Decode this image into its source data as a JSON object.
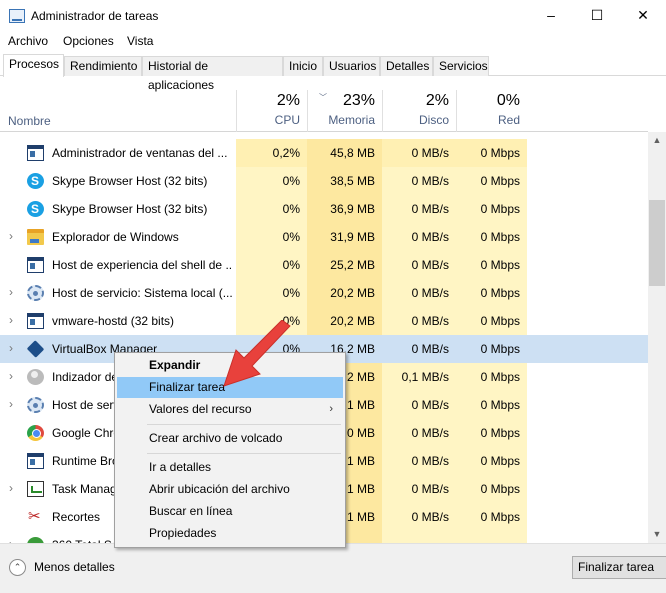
{
  "window": {
    "title": "Administrador de tareas",
    "minimize_icon": "–",
    "maximize_icon": "☐",
    "close_icon": "✕"
  },
  "menu": [
    "Archivo",
    "Opciones",
    "Vista"
  ],
  "tabs": [
    "Procesos",
    "Rendimiento",
    "Historial de aplicaciones",
    "Inicio",
    "Usuarios",
    "Detalles",
    "Servicios"
  ],
  "active_tab": "Procesos",
  "columns": {
    "name": "Nombre",
    "cpu": {
      "pct": "2%",
      "label": "CPU"
    },
    "memory": {
      "pct": "23%",
      "label": "Memoria"
    },
    "disk": {
      "pct": "2%",
      "label": "Disco"
    },
    "network": {
      "pct": "0%",
      "label": "Red"
    }
  },
  "processes": [
    {
      "name": "Administrador de ventanas del ...",
      "icon": "window-icon",
      "expandable": false,
      "cpu": "0,2%",
      "memory": "45,8 MB",
      "disk": "0 MB/s",
      "network": "0 Mbps"
    },
    {
      "name": "Skype Browser Host (32 bits)",
      "icon": "skype-icon",
      "expandable": false,
      "cpu": "0%",
      "memory": "38,5 MB",
      "disk": "0 MB/s",
      "network": "0 Mbps"
    },
    {
      "name": "Skype Browser Host (32 bits)",
      "icon": "skype-icon",
      "expandable": false,
      "cpu": "0%",
      "memory": "36,9 MB",
      "disk": "0 MB/s",
      "network": "0 Mbps"
    },
    {
      "name": "Explorador de Windows",
      "icon": "folder-icon",
      "expandable": true,
      "cpu": "0%",
      "memory": "31,9 MB",
      "disk": "0 MB/s",
      "network": "0 Mbps"
    },
    {
      "name": "Host de experiencia del shell de ...",
      "icon": "window-icon",
      "expandable": false,
      "cpu": "0%",
      "memory": "25,2 MB",
      "disk": "0 MB/s",
      "network": "0 Mbps"
    },
    {
      "name": "Host de servicio: Sistema local (...",
      "icon": "gear-icon",
      "expandable": true,
      "cpu": "0%",
      "memory": "20,2 MB",
      "disk": "0 MB/s",
      "network": "0 Mbps"
    },
    {
      "name": "vmware-hostd (32 bits)",
      "icon": "window-icon",
      "expandable": true,
      "cpu": "0%",
      "memory": "20,2 MB",
      "disk": "0 MB/s",
      "network": "0 Mbps"
    },
    {
      "name": "VirtualBox Manager",
      "icon": "virtualbox-icon",
      "expandable": true,
      "cpu": "0%",
      "memory": "16,2 MB",
      "disk": "0 MB/s",
      "network": "0 Mbps",
      "selected": true
    },
    {
      "name": "Indizador de",
      "icon": "user-icon",
      "expandable": true,
      "cpu": "",
      "memory": "2 MB",
      "disk": "0,1 MB/s",
      "network": "0 Mbps"
    },
    {
      "name": "Host de serv",
      "icon": "gear-icon",
      "expandable": true,
      "cpu": "",
      "memory": "1 MB",
      "disk": "0 MB/s",
      "network": "0 Mbps"
    },
    {
      "name": "Google Chro",
      "icon": "chrome-icon",
      "expandable": false,
      "cpu": "",
      "memory": "0 MB",
      "disk": "0 MB/s",
      "network": "0 Mbps"
    },
    {
      "name": "Runtime Bro",
      "icon": "window-icon",
      "expandable": false,
      "cpu": "",
      "memory": "1 MB",
      "disk": "0 MB/s",
      "network": "0 Mbps"
    },
    {
      "name": "Task Manag",
      "icon": "task-manager-icon",
      "expandable": true,
      "cpu": "",
      "memory": "1 MB",
      "disk": "0 MB/s",
      "network": "0 Mbps"
    },
    {
      "name": "Recortes",
      "icon": "scissors-icon",
      "expandable": false,
      "cpu": "",
      "memory": "1 MB",
      "disk": "0 MB/s",
      "network": "0 Mbps"
    },
    {
      "name": "360 Total Se",
      "icon": "shield-360-icon",
      "expandable": true,
      "cpu": "",
      "memory": "",
      "disk": "",
      "network": ""
    }
  ],
  "context_menu": {
    "expand": "Expandir",
    "end_task": "Finalizar tarea",
    "resource_values": "Valores del recurso",
    "create_dump": "Crear archivo de volcado",
    "go_to_details": "Ir a detalles",
    "open_file_location": "Abrir ubicación del archivo",
    "search_online": "Buscar en línea",
    "properties": "Propiedades",
    "submenu_arrow": "›"
  },
  "footer": {
    "less_details": "Menos detalles",
    "end_task_button": "Finalizar tarea",
    "collapse_icon": "⌃"
  },
  "colors": {
    "selected_row": "#cde0f3",
    "highlight": "#91c9f7",
    "heat_light": "#fff5c4",
    "arrow_red": "#e8413c"
  }
}
